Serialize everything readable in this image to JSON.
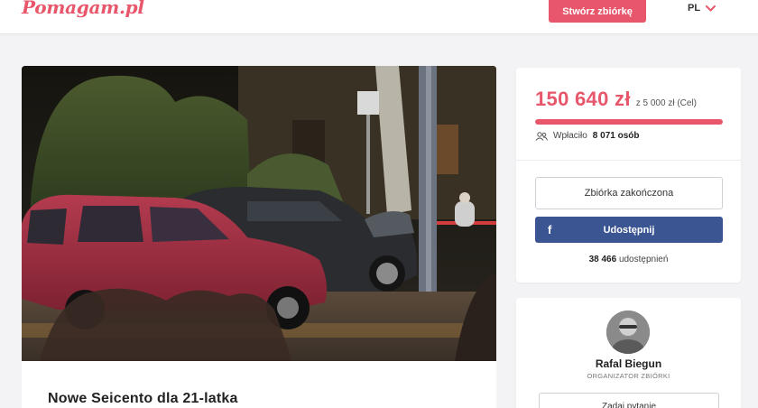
{
  "header": {
    "logo_text": "Pomagam.pl",
    "create_button": "Stwórz zbiórkę",
    "language": "PL"
  },
  "fundraiser": {
    "title": "Nowe Seicento dla 21-latka",
    "photo_icon": "car-accident-photo"
  },
  "donation": {
    "amount": "150 640 zł",
    "goal": "z 5 000 zł (Cel)",
    "progress_fraction": 1.0,
    "donors_prefix": "Wpłaciło",
    "donors_count": "8 071 osób",
    "ended_label": "Zbiórka zakończona",
    "share_label": "Udostępnij",
    "share_icon": "facebook-icon",
    "shares_count": "38 466",
    "shares_suffix": "udostępnień"
  },
  "organizer": {
    "name": "Rafal Biegun",
    "role": "ORGANIZATOR ZBIÓRKI",
    "ask_label": "Zadaj pytanie"
  },
  "colors": {
    "brand": "#e8566b",
    "facebook": "#3b5593",
    "background": "#f3f3f5"
  }
}
